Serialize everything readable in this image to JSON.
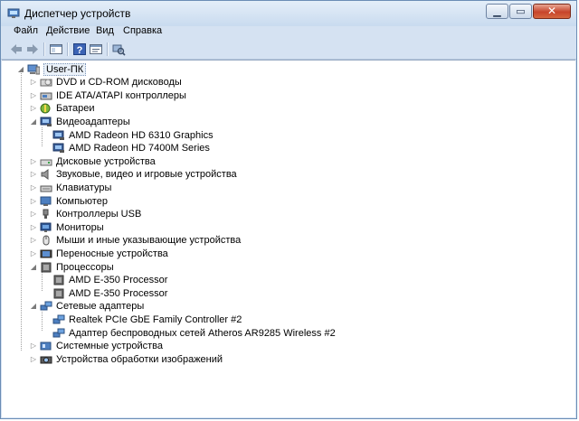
{
  "window": {
    "title": "Диспетчер устройств"
  },
  "menu": [
    "Файл",
    "Действие",
    "Вид",
    "Справка"
  ],
  "tree": {
    "root": "User-ПК",
    "categories": [
      {
        "label": "DVD и CD-ROM дисководы",
        "icon": "dvd-drive-icon",
        "expanded": false,
        "children": []
      },
      {
        "label": "IDE ATA/ATAPI контроллеры",
        "icon": "ide-controller-icon",
        "expanded": false,
        "children": []
      },
      {
        "label": "Батареи",
        "icon": "battery-icon",
        "expanded": false,
        "children": []
      },
      {
        "label": "Видеоадаптеры",
        "icon": "display-adapter-icon",
        "expanded": true,
        "children": [
          "AMD Radeon HD 6310 Graphics",
          "AMD Radeon HD 7400M Series"
        ]
      },
      {
        "label": "Дисковые устройства",
        "icon": "disk-drive-icon",
        "expanded": false,
        "children": []
      },
      {
        "label": "Звуковые, видео и игровые устройства",
        "icon": "speaker-icon",
        "expanded": false,
        "children": []
      },
      {
        "label": "Клавиатуры",
        "icon": "keyboard-icon",
        "expanded": false,
        "children": []
      },
      {
        "label": "Компьютер",
        "icon": "computer-icon",
        "expanded": false,
        "children": []
      },
      {
        "label": "Контроллеры USB",
        "icon": "usb-icon",
        "expanded": false,
        "children": []
      },
      {
        "label": "Мониторы",
        "icon": "monitor-icon",
        "expanded": false,
        "children": []
      },
      {
        "label": "Мыши и иные указывающие устройства",
        "icon": "mouse-icon",
        "expanded": false,
        "children": []
      },
      {
        "label": "Переносные устройства",
        "icon": "portable-device-icon",
        "expanded": false,
        "children": []
      },
      {
        "label": "Процессоры",
        "icon": "processor-icon",
        "expanded": true,
        "children": [
          "AMD E-350 Processor",
          "AMD E-350 Processor"
        ]
      },
      {
        "label": "Сетевые адаптеры",
        "icon": "network-adapter-icon",
        "expanded": true,
        "children": [
          "Realtek PCIe GbE Family Controller #2",
          "Адаптер беспроводных сетей Atheros AR9285 Wireless #2"
        ]
      },
      {
        "label": "Системные устройства",
        "icon": "system-device-icon",
        "expanded": false,
        "children": []
      },
      {
        "label": "Устройства обработки изображений",
        "icon": "imaging-device-icon",
        "expanded": false,
        "children": []
      }
    ]
  }
}
